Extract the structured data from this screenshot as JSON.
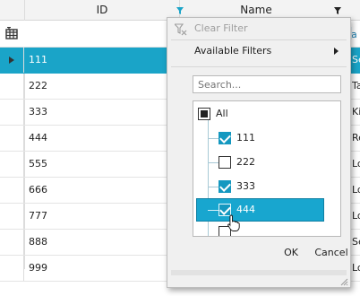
{
  "columns": {
    "id": "ID",
    "name": "Name"
  },
  "rows": [
    {
      "id": "111",
      "name": "Se",
      "selected": true
    },
    {
      "id": "222",
      "name": "Ta"
    },
    {
      "id": "333",
      "name": "Ki"
    },
    {
      "id": "444",
      "name": "Re"
    },
    {
      "id": "555",
      "name": "Lo"
    },
    {
      "id": "666",
      "name": "Lo"
    },
    {
      "id": "777",
      "name": "Lo"
    },
    {
      "id": "888",
      "name": "Se"
    },
    {
      "id": "999",
      "name": "Lo"
    }
  ],
  "filter_row_hint": "a",
  "popup": {
    "clear_filter": "Clear Filter",
    "available_filters": "Available Filters",
    "search_placeholder": "Search...",
    "items": [
      {
        "label": "All",
        "state": "partial"
      },
      {
        "label": "111",
        "state": "checked"
      },
      {
        "label": "222",
        "state": "unchecked"
      },
      {
        "label": "333",
        "state": "checked"
      },
      {
        "label": "444",
        "state": "checked",
        "highlighted": true
      }
    ],
    "ok_label": "OK",
    "cancel_label": "Cancel"
  },
  "colors": {
    "accent": "#1aa4c8",
    "check": "#1498c0"
  }
}
